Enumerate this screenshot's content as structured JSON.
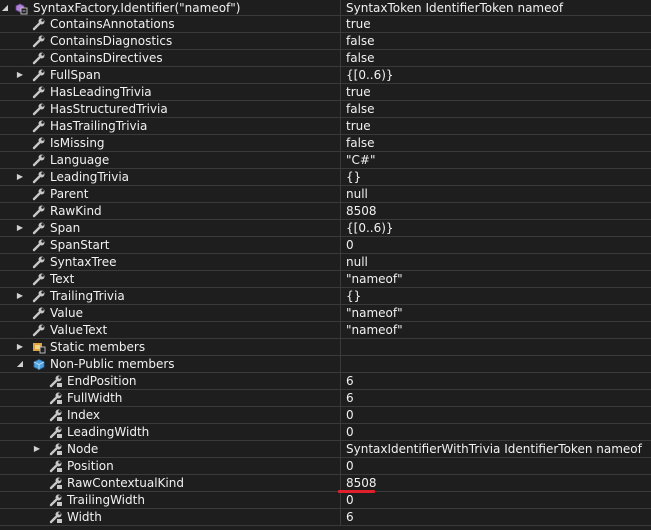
{
  "rows": [
    {
      "name": "SyntaxFactory.Identifier(\"nameof\")",
      "value": "SyntaxToken IdentifierToken nameof"
    },
    {
      "name": "ContainsAnnotations",
      "value": "true"
    },
    {
      "name": "ContainsDiagnostics",
      "value": "false"
    },
    {
      "name": "ContainsDirectives",
      "value": "false"
    },
    {
      "name": "FullSpan",
      "value": "{[0..6)}"
    },
    {
      "name": "HasLeadingTrivia",
      "value": "true"
    },
    {
      "name": "HasStructuredTrivia",
      "value": "false"
    },
    {
      "name": "HasTrailingTrivia",
      "value": "true"
    },
    {
      "name": "IsMissing",
      "value": "false"
    },
    {
      "name": "Language",
      "value": "\"C#\""
    },
    {
      "name": "LeadingTrivia",
      "value": "{}"
    },
    {
      "name": "Parent",
      "value": "null"
    },
    {
      "name": "RawKind",
      "value": "8508"
    },
    {
      "name": "Span",
      "value": "{[0..6)}"
    },
    {
      "name": "SpanStart",
      "value": "0"
    },
    {
      "name": "SyntaxTree",
      "value": "null"
    },
    {
      "name": "Text",
      "value": "\"nameof\""
    },
    {
      "name": "TrailingTrivia",
      "value": "{}"
    },
    {
      "name": "Value",
      "value": "\"nameof\""
    },
    {
      "name": "ValueText",
      "value": "\"nameof\""
    },
    {
      "name": "Static members",
      "value": ""
    },
    {
      "name": "Non-Public members",
      "value": ""
    },
    {
      "name": "EndPosition",
      "value": "6"
    },
    {
      "name": "FullWidth",
      "value": "6"
    },
    {
      "name": "Index",
      "value": "0"
    },
    {
      "name": "LeadingWidth",
      "value": "0"
    },
    {
      "name": "Node",
      "value": "SyntaxIdentifierWithTrivia IdentifierToken nameof"
    },
    {
      "name": "Position",
      "value": "0"
    },
    {
      "name": "RawContextualKind",
      "value": "8508"
    },
    {
      "name": "TrailingWidth",
      "value": "0"
    },
    {
      "name": "Width",
      "value": "6"
    }
  ],
  "colors": {
    "background": "#1e1e1e",
    "grid_line": "#3a3a3a",
    "text": "#f1f1f1",
    "annotation_underline": "#e0202a"
  }
}
